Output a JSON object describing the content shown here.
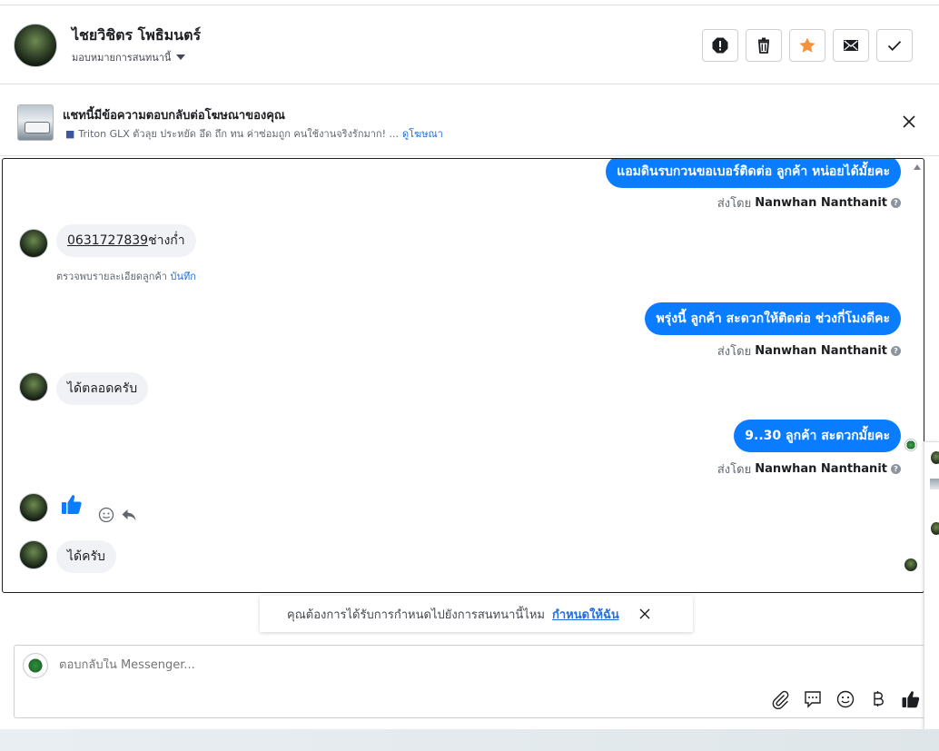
{
  "header": {
    "name": "ไชยวิชิตร โพธิมนตร์",
    "assign_label": "มอบหมายการสนทนานี้",
    "actions": [
      "spam-icon",
      "trash-icon",
      "star-icon",
      "envelope-icon",
      "check-icon"
    ],
    "star_color": "#f7923a"
  },
  "ad": {
    "title": "แชทนี้มีข้อความตอบกลับต่อโฆษณาของคุณ",
    "description": "Triton GLX ตัวลุย ประหยัด อึด ถึก ทน ค่าซ่อมถูก คนใช้งานจริงรักมาก! ...",
    "view_link": "ดูโฆษณา"
  },
  "messages": {
    "m1": {
      "text": "แอมดินรบกวนขอเบอร์ติดต่อ ลูกค้า  หน่อยได้มั้ยคะ"
    },
    "m1_sent": {
      "prefix": "ส่งโดย",
      "agent": "Nanwhan Nanthanit"
    },
    "m2": {
      "phone": "0631727839",
      "rest": "ช่างก่ำ"
    },
    "m2_note": {
      "text": "ตรวจพบรายละเอียดลูกค้า",
      "link": "บันทึก"
    },
    "m3": {
      "text": "พรุ่งนี้ ลูกค้า สะดวกให้ติดต่อ ช่วงกี่โมงดีคะ"
    },
    "m3_sent": {
      "prefix": "ส่งโดย",
      "agent": "Nanwhan Nanthanit"
    },
    "m4": {
      "text": "ได้ตลอดครับ"
    },
    "m5": {
      "text": "9..30 ลูกค้า สะดวกมั้ยคะ"
    },
    "m5_sent": {
      "prefix": "ส่งโดย",
      "agent": "Nanwhan Nanthanit"
    },
    "m7": {
      "text": "ได้ครับ"
    }
  },
  "prompt": {
    "text": "คุณต้องการได้รับการกำหนดไปยังการสนทนานี้ไหม",
    "link": "กำหนดให้ฉัน"
  },
  "composer": {
    "placeholder": "ตอบกลับใน Messenger...",
    "tools": [
      "attach-icon",
      "saved-reply-icon",
      "emoji-icon",
      "baht-icon",
      "thumbs-up-icon"
    ]
  },
  "colors": {
    "outgoing": "#0a7cff",
    "incoming": "#f0f2f5",
    "link": "#216fdb"
  }
}
